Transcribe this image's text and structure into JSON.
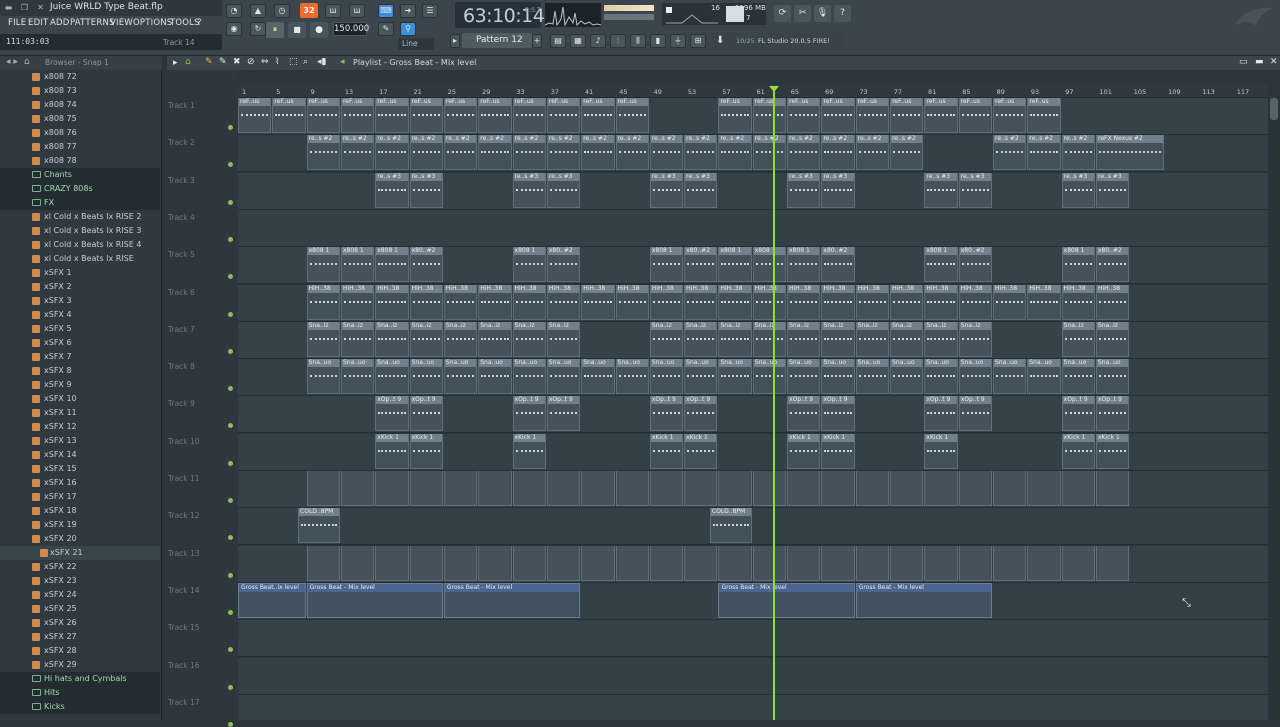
{
  "window": {
    "title": "Juice WRLD Type Beat.flp"
  },
  "menu": [
    "FILE",
    "EDIT",
    "ADD",
    "PATTERNS",
    "VIEW",
    "OPTIONS",
    "TOOLS",
    "?"
  ],
  "hint": {
    "time": "111:03:03",
    "track": "Track 14"
  },
  "transport": {
    "play_icon": "⏸",
    "stop_icon": "■",
    "rec_icon": "●",
    "song_pat": "32",
    "bpm": "150.000"
  },
  "time_display": {
    "value": "63:10:14",
    "unit": "B:S:T"
  },
  "cpu": {
    "value": "16",
    "memory": "1196 MB",
    "polyphony": "7"
  },
  "snap": "Line",
  "pattern": "Pattern 12",
  "news": {
    "count": "10/25",
    "text": "FL Studio 20.0.5 FIRE!"
  },
  "browser": {
    "title": "Browser - Snap 1",
    "items": [
      {
        "label": "x808 72",
        "type": "file"
      },
      {
        "label": "x808 73",
        "type": "file"
      },
      {
        "label": "x808 74",
        "type": "file"
      },
      {
        "label": "x808 75",
        "type": "file"
      },
      {
        "label": "x808 76",
        "type": "file"
      },
      {
        "label": "x808 77",
        "type": "file"
      },
      {
        "label": "x808 78",
        "type": "file"
      },
      {
        "label": "Chants",
        "type": "folder"
      },
      {
        "label": "CRAZY 808s",
        "type": "folder"
      },
      {
        "label": "FX",
        "type": "folder"
      },
      {
        "label": "xl Cold x Beats lx RISE 2",
        "type": "file"
      },
      {
        "label": "xl Cold x Beats lx RISE 3",
        "type": "file"
      },
      {
        "label": "xl Cold x Beats lx RISE 4",
        "type": "file"
      },
      {
        "label": "xl Cold x Beats lx RISE",
        "type": "file"
      },
      {
        "label": "xSFX 1",
        "type": "file"
      },
      {
        "label": "xSFX 2",
        "type": "file"
      },
      {
        "label": "xSFX 3",
        "type": "file"
      },
      {
        "label": "xSFX 4",
        "type": "file"
      },
      {
        "label": "xSFX 5",
        "type": "file"
      },
      {
        "label": "xSFX 6",
        "type": "file"
      },
      {
        "label": "xSFX 7",
        "type": "file"
      },
      {
        "label": "xSFX 8",
        "type": "file"
      },
      {
        "label": "xSFX 9",
        "type": "file"
      },
      {
        "label": "xSFX 10",
        "type": "file"
      },
      {
        "label": "xSFX 11",
        "type": "file"
      },
      {
        "label": "xSFX 12",
        "type": "file"
      },
      {
        "label": "xSFX 13",
        "type": "file"
      },
      {
        "label": "xSFX 14",
        "type": "file"
      },
      {
        "label": "xSFX 15",
        "type": "file"
      },
      {
        "label": "xSFX 16",
        "type": "file"
      },
      {
        "label": "xSFX 17",
        "type": "file"
      },
      {
        "label": "xSFX 18",
        "type": "file"
      },
      {
        "label": "xSFX 19",
        "type": "file"
      },
      {
        "label": "xSFX 20",
        "type": "file"
      },
      {
        "label": "xSFX 21",
        "type": "file",
        "selected": true
      },
      {
        "label": "xSFX 22",
        "type": "file"
      },
      {
        "label": "xSFX 23",
        "type": "file"
      },
      {
        "label": "xSFX 24",
        "type": "file"
      },
      {
        "label": "xSFX 25",
        "type": "file"
      },
      {
        "label": "xSFX 26",
        "type": "file"
      },
      {
        "label": "xSFX 27",
        "type": "file"
      },
      {
        "label": "xSFX 28",
        "type": "file"
      },
      {
        "label": "xSFX 29",
        "type": "file"
      },
      {
        "label": "Hi hats and Cymbals",
        "type": "folder"
      },
      {
        "label": "Hits",
        "type": "folder"
      },
      {
        "label": "Kicks",
        "type": "folder"
      }
    ]
  },
  "playlist": {
    "title": "Playlist - Gross Beat - Mix level",
    "ruler": [
      "1",
      "5",
      "9",
      "13",
      "17",
      "21",
      "25",
      "29",
      "33",
      "37",
      "41",
      "45",
      "49",
      "53",
      "57",
      "61",
      "65",
      "69",
      "73",
      "77",
      "81",
      "85",
      "89",
      "93",
      "97",
      "101",
      "105",
      "109",
      "113",
      "117"
    ],
    "tracks": [
      "Track 1",
      "Track 2",
      "Track 3",
      "Track 4",
      "Track 5",
      "Track 6",
      "Track 7",
      "Track 8",
      "Track 9",
      "Track 10",
      "Track 11",
      "Track 12",
      "Track 13",
      "Track 14",
      "Track 15",
      "Track 16",
      "Track 17"
    ],
    "clip_labels": {
      "t1": "reF..us",
      "t2": "re..s #2",
      "t2_end": "reFX Nexus #2",
      "t3": "re..s #3",
      "t5a": "x808 1",
      "t5b": "x80..#2",
      "t6": "HiH..38",
      "t7": "Sna..iz",
      "t8": "Sna..uo",
      "t9": "xOp..t 9",
      "t10": "xKick 1",
      "t12": "COLD..8PM",
      "t14a": "Gross Beat..ix level",
      "t14b": "Gross Beat - Mix level"
    }
  }
}
